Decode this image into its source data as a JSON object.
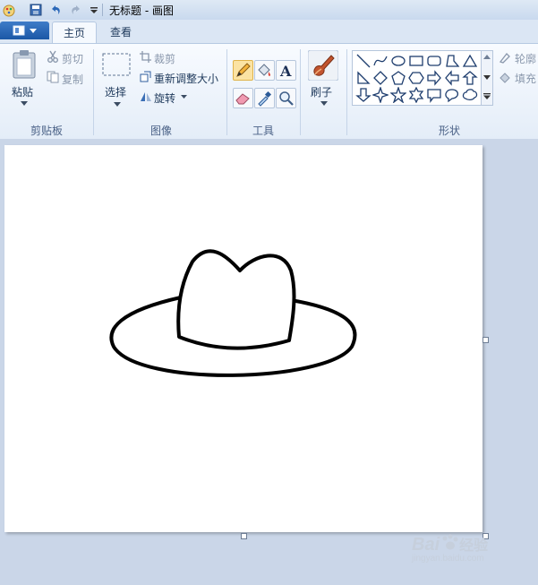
{
  "window": {
    "title": "无标题 - 画图"
  },
  "tabs": [
    {
      "label": "主页",
      "active": true
    },
    {
      "label": "查看",
      "active": false
    }
  ],
  "ribbon": {
    "clipboard": {
      "paste": "粘贴",
      "cut": "剪切",
      "copy": "复制",
      "group": "剪贴板"
    },
    "image": {
      "select": "选择",
      "crop": "裁剪",
      "resize": "重新调整大小",
      "rotate": "旋转",
      "group": "图像"
    },
    "tools": {
      "group": "工具",
      "selected": "pencil"
    },
    "brushes": {
      "label": "刷子"
    },
    "shapes": {
      "group": "形状",
      "outline": "轮廓",
      "fill": "填充"
    }
  },
  "colors": {
    "accent": "#1b57a6",
    "selected_tool": "#fbe3a3"
  },
  "watermark": {
    "brand": "Bai",
    "brand2": "经验",
    "url": "jingyan.baidu.com"
  }
}
